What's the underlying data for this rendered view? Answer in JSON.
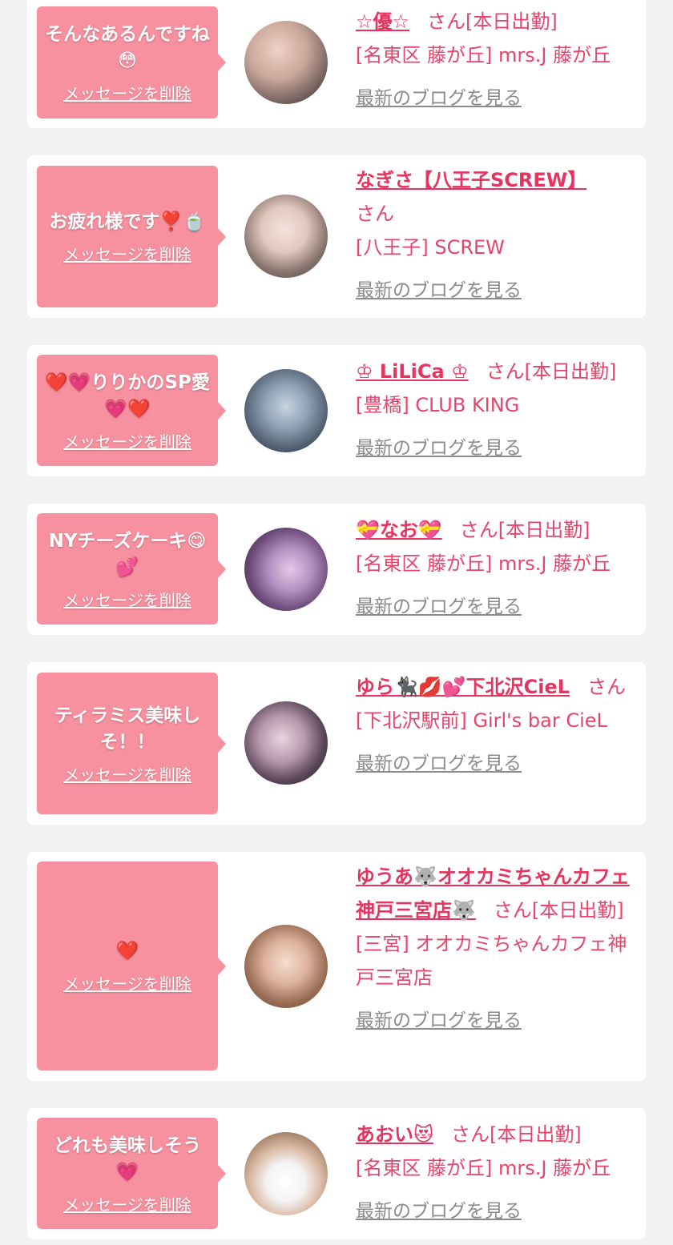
{
  "delete_label": "メッセージを削除",
  "blog_label": "最新のブログを見る",
  "colors": {
    "bubble": "#f7909f",
    "accent": "#e6335f",
    "text": "#e8436b",
    "link_gray": "#8b8b8b",
    "background": "#f2f2f2"
  },
  "items": [
    {
      "message": "そんなあるんですね😳",
      "name": "☆優☆",
      "suffix": "さん[本日出勤]",
      "shop": "[名東区 藤が丘] mrs.J 藤が丘",
      "avatar": "avatar-girl-1"
    },
    {
      "message": "お疲れ様です❣️🍵",
      "name": "なぎさ【八王子SCREW】",
      "suffix": "さん",
      "shop": "[八王子] SCREW",
      "avatar": "avatar-girl-2"
    },
    {
      "message": "❤️💗りりかのSP愛💗❤️",
      "name": "♔ LiLiCa ♔",
      "suffix": "さん[本日出勤]",
      "shop": "[豊橋] CLUB KING",
      "avatar": "avatar-girl-3"
    },
    {
      "message": "NYチーズケーキ😋💕",
      "name": "💝なお💝",
      "suffix": "さん[本日出勤]",
      "shop": "[名東区 藤が丘] mrs.J 藤が丘",
      "avatar": "avatar-girl-4"
    },
    {
      "message": "ティラミス美味しそ！！",
      "name": "ゆら🐈‍⬛💋💕下北沢CieL",
      "suffix": "さん",
      "shop": "[下北沢駅前] Girl's bar CieL",
      "avatar": "avatar-girl-5"
    },
    {
      "message": "❤️",
      "name": "ゆうあ🐺オオカミちゃんカフェ神戸三宮店🐺",
      "suffix": "さん[本日出勤]",
      "shop": "[三宮] オオカミちゃんカフェ神戸三宮店",
      "avatar": "avatar-girl-6"
    },
    {
      "message": "どれも美味しそう💗",
      "name": "あおい😻",
      "suffix": "さん[本日出勤]",
      "shop": "[名東区 藤が丘] mrs.J 藤が丘",
      "avatar": "avatar-girl-7"
    }
  ]
}
